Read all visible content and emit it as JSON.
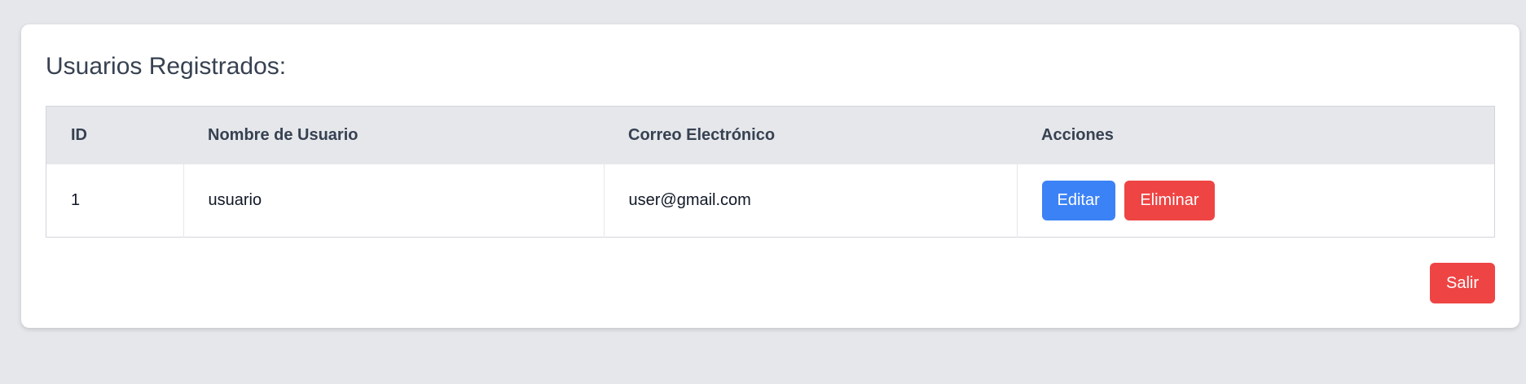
{
  "page": {
    "title": "Usuarios Registrados:"
  },
  "table": {
    "headers": {
      "id": "ID",
      "username": "Nombre de Usuario",
      "email": "Correo Electrónico",
      "actions": "Acciones"
    },
    "rows": [
      {
        "id": "1",
        "username": "usuario",
        "email": "user@gmail.com",
        "edit_label": "Editar",
        "delete_label": "Eliminar"
      }
    ]
  },
  "footer": {
    "exit_label": "Salir"
  },
  "colors": {
    "background": "#e5e7eb",
    "edit_button": "#3b82f6",
    "delete_button": "#ef4444",
    "exit_button": "#ef4444"
  }
}
